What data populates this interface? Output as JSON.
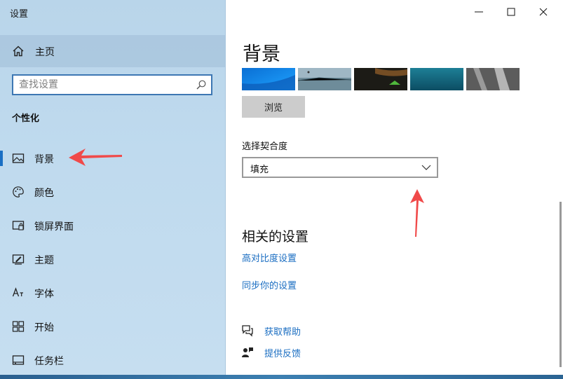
{
  "window": {
    "title": "设置"
  },
  "sidebar": {
    "home_label": "主页",
    "search_placeholder": "查找设置",
    "section_title": "个性化",
    "items": [
      {
        "label": "背景",
        "icon": "picture-icon",
        "active": true
      },
      {
        "label": "颜色",
        "icon": "palette-icon",
        "active": false
      },
      {
        "label": "锁屏界面",
        "icon": "lock-screen-icon",
        "active": false
      },
      {
        "label": "主题",
        "icon": "theme-icon",
        "active": false
      },
      {
        "label": "字体",
        "icon": "font-icon",
        "active": false
      },
      {
        "label": "开始",
        "icon": "start-icon",
        "active": false
      },
      {
        "label": "任务栏",
        "icon": "taskbar-icon",
        "active": false
      }
    ]
  },
  "main": {
    "title": "背景",
    "browse_label": "浏览",
    "fit_label": "选择契合度",
    "fit_value": "填充",
    "related_title": "相关的设置",
    "links": [
      "高对比度设置",
      "同步你的设置"
    ],
    "help": [
      {
        "label": "获取帮助",
        "icon": "help-chat-icon"
      },
      {
        "label": "提供反馈",
        "icon": "feedback-icon"
      }
    ]
  },
  "colors": {
    "accent": "#1a6fc4",
    "annotation": "#f04a4a",
    "link": "#1b6ec2"
  }
}
